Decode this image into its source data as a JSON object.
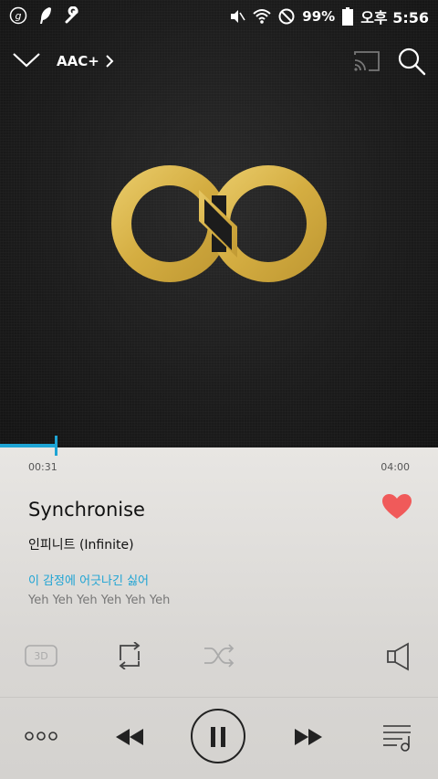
{
  "status_bar": {
    "battery": "99%",
    "time": "오후 5:56"
  },
  "topbar": {
    "codec": "AAC+"
  },
  "player": {
    "current_time": "00:31",
    "total_time": "04:00",
    "progress_fraction": 0.13,
    "title": "Synchronise",
    "artist": "인피니트 (Infinite)",
    "lyric_current": "이 감정에 어긋나긴 싫어",
    "lyric_next": "Yeh Yeh Yeh Yeh Yeh Yeh",
    "favorited": true
  },
  "controls": {
    "three_d_label": "3D"
  },
  "colors": {
    "accent": "#1ea4d4",
    "heart": "#f05a5a",
    "logo_gold": "#d9b44a"
  }
}
